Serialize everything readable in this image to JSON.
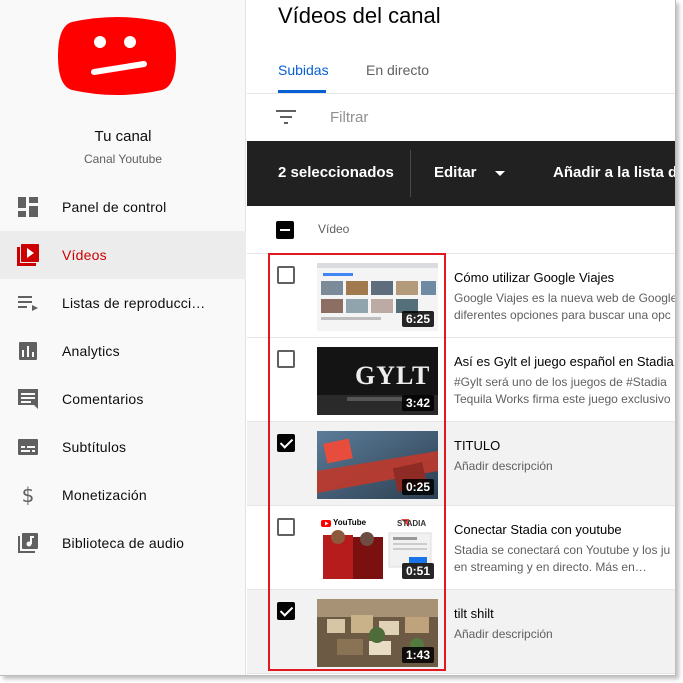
{
  "sidebar": {
    "channel_name": "Tu canal",
    "channel_subtitle": "Canal Youtube",
    "items": [
      {
        "label": "Panel de control",
        "icon": "dashboard-icon"
      },
      {
        "label": "Vídeos",
        "icon": "videos-icon",
        "active": true
      },
      {
        "label": "Listas de reproducci…",
        "icon": "playlists-icon"
      },
      {
        "label": "Analytics",
        "icon": "analytics-icon"
      },
      {
        "label": "Comentarios",
        "icon": "comments-icon"
      },
      {
        "label": "Subtítulos",
        "icon": "subtitles-icon"
      },
      {
        "label": "Monetización",
        "icon": "dollar-icon"
      },
      {
        "label": "Biblioteca de audio",
        "icon": "audio-library-icon"
      }
    ]
  },
  "main": {
    "title": "Vídeos del canal",
    "tabs": [
      {
        "label": "Subidas",
        "active": true
      },
      {
        "label": "En directo",
        "active": false
      }
    ],
    "filter_placeholder": "Filtrar",
    "action_bar": {
      "selected": "2 seleccionados",
      "edit": "Editar",
      "add_to_list": "Añadir a la lista de"
    },
    "table_header": "Vídeo",
    "videos": [
      {
        "title": "Cómo utilizar Google Viajes",
        "description": "Google Viajes es la nueva web de Google\ndiferentes opciones para buscar una opc",
        "duration": "6:25",
        "checked": false
      },
      {
        "title": "Así es Gylt el juego español en Stadia.",
        "description": "#Gylt será uno de los juegos de #Stadia\nTequila Works firma este juego exclusivo",
        "duration": "3:42",
        "checked": false,
        "thumb_text": "GYLT"
      },
      {
        "title": "TITULO",
        "description": "Añadir descripción",
        "duration": "0:25",
        "checked": true
      },
      {
        "title": "Conectar Stadia con youtube",
        "description": "Stadia se conectará con Youtube y los ju\nen streaming y en directo. Más en…",
        "duration": "0:51",
        "checked": false,
        "thumb_labels": [
          "YouTube",
          "STADIA"
        ]
      },
      {
        "title": "tilt shilt",
        "description": "Añadir descripción",
        "duration": "1:43",
        "checked": true
      }
    ]
  },
  "colors": {
    "accent": "#065fd4",
    "brand_red": "#ff0000",
    "active_nav": "#cc0000",
    "action_bar": "#212121",
    "highlight": "#e2171f"
  }
}
